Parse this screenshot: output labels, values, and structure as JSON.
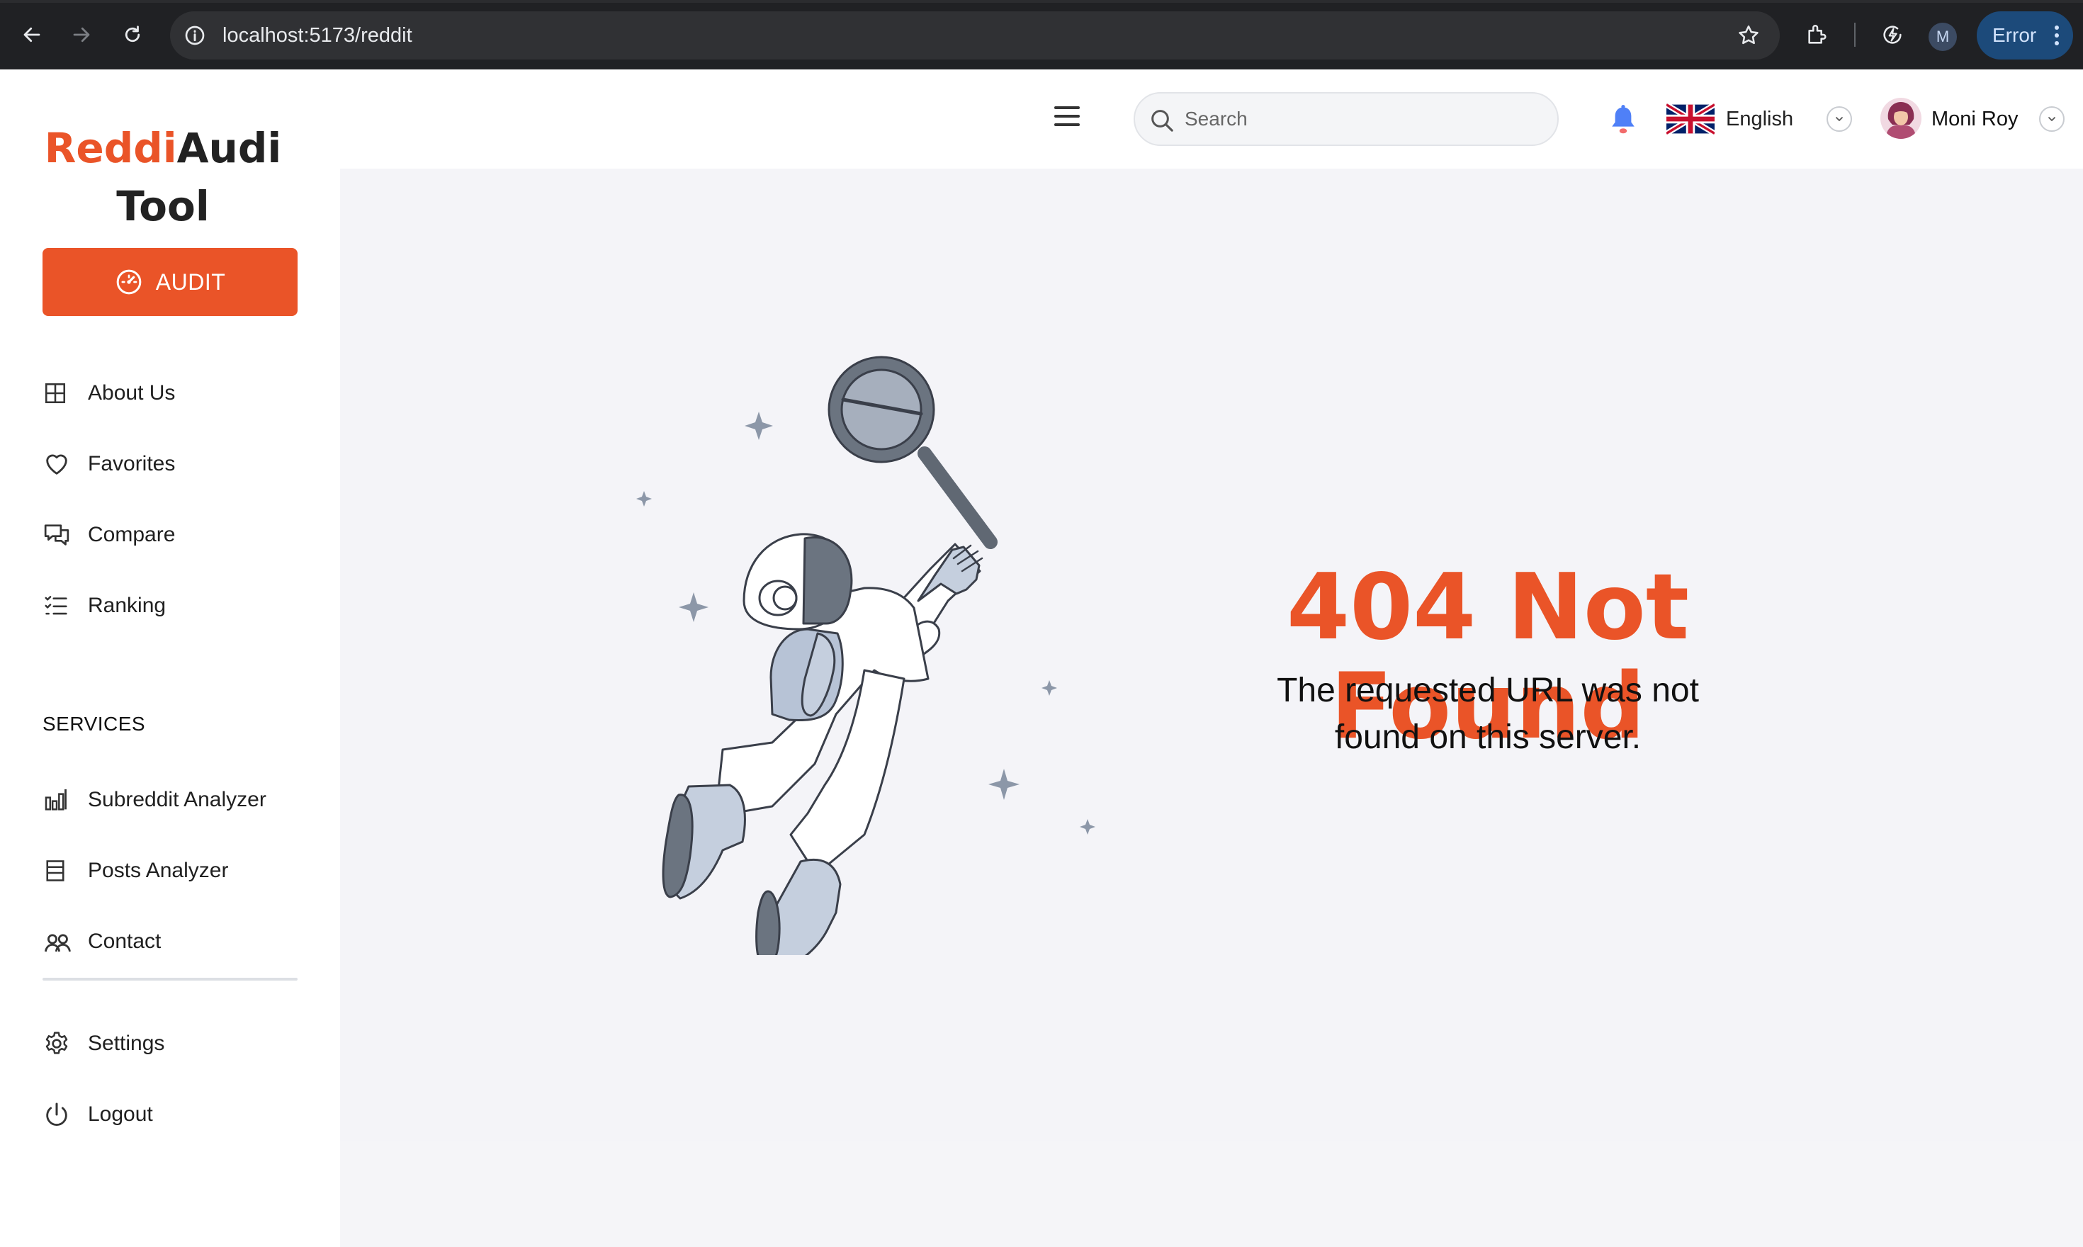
{
  "browser": {
    "url": "localhost:5173/reddit",
    "profile_initial": "M",
    "error_label": "Error"
  },
  "sidebar": {
    "logo_part1": "Reddi",
    "logo_part2": "Audi",
    "logo_part3": "Tool",
    "audit_label": "AUDIT",
    "items": [
      {
        "label": "About Us",
        "icon": "grid-icon"
      },
      {
        "label": "Favorites",
        "icon": "heart-icon"
      },
      {
        "label": "Compare",
        "icon": "chat-bubbles-icon"
      },
      {
        "label": "Ranking",
        "icon": "checklist-icon"
      }
    ],
    "services_label": "SERVICES",
    "services": [
      {
        "label": "Subreddit Analyzer",
        "icon": "bar-chart-icon"
      },
      {
        "label": "Posts Analyzer",
        "icon": "document-icon"
      },
      {
        "label": "Contact",
        "icon": "users-icon"
      }
    ],
    "bottom": [
      {
        "label": "Settings",
        "icon": "gear-icon"
      },
      {
        "label": "Logout",
        "icon": "power-icon"
      }
    ]
  },
  "topbar": {
    "search_placeholder": "Search",
    "language": "English",
    "user_name": "Moni Roy"
  },
  "main": {
    "title": "404 Not Found",
    "message": "The requested URL was not found on this server."
  },
  "colors": {
    "accent": "#ea5428",
    "main_bg": "#f4f4f8",
    "chrome_bg": "#202124"
  }
}
